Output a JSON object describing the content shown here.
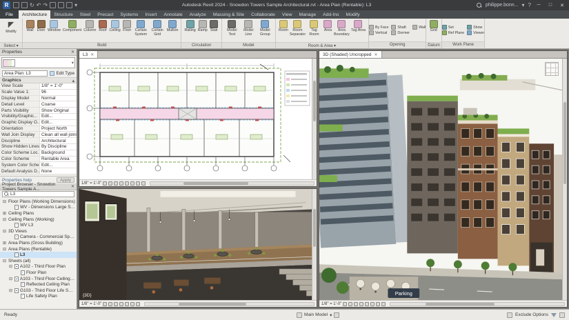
{
  "colors": {
    "accent": "#0696d7",
    "titlebar": "#393b3d",
    "area_pink": "#f6d7e7",
    "area_green": "#e3efd3",
    "roof_green": "#7fae4e",
    "selection": "#cde3f7"
  },
  "icons": {
    "undo": "↶",
    "redo": "↷",
    "sync": "↻",
    "close": "✕",
    "minimize": "─",
    "maximize": "□",
    "dropdown": "▾",
    "collapse": "▴",
    "help": "?",
    "cursor": "◤"
  },
  "title_bar": {
    "logo_letter": "R",
    "title": "Autodesk Revit 2024 - Snowdon Towers Sample Architectural.rvt - Area Plan (Rentable): L3",
    "user": "philippe.bonn..."
  },
  "menu": {
    "file": "File",
    "tabs": [
      {
        "label": "Architecture"
      },
      {
        "label": "Structure"
      },
      {
        "label": "Steel"
      },
      {
        "label": "Precast"
      },
      {
        "label": "Systems"
      },
      {
        "label": "Insert"
      },
      {
        "label": "Annotate"
      },
      {
        "label": "Analyze"
      },
      {
        "label": "Massing & Site"
      },
      {
        "label": "Collaborate"
      },
      {
        "label": "View"
      },
      {
        "label": "Manage"
      },
      {
        "label": "Add-Ins"
      },
      {
        "label": "Modify"
      }
    ]
  },
  "ribbon": {
    "modify_label": "Modify",
    "panel_select": "Select ▾",
    "build": [
      "Wall",
      "Door",
      "Window",
      "Component",
      "Column",
      "Roof",
      "Ceiling",
      "Floor",
      "Curtain System",
      "Curtain Grid",
      "Mullion"
    ],
    "panel_build": "Build",
    "circulation": [
      "Railing",
      "Ramp",
      "Stair"
    ],
    "panel_circulation": "Circulation",
    "model": [
      "Model Text",
      "Model Line",
      "Model Group"
    ],
    "panel_model": "Model",
    "room_area": [
      "Room",
      "Room Separator",
      "Tag Room",
      "Area",
      "Area Boundary",
      "Tag Area"
    ],
    "panel_room_area": "Room & Area ▾",
    "opening": [
      "By Face",
      "Shaft",
      "Wall",
      "Vertical",
      "Dormer"
    ],
    "panel_opening": "Opening",
    "datum": [
      "Grid"
    ],
    "panel_datum": "Datum",
    "work_plane": [
      "Set",
      "Show",
      "Ref Plane",
      "Viewer"
    ],
    "panel_work_plane": "Work Plane"
  },
  "properties": {
    "header": "Properties",
    "type_selector": "Area Plan: L3",
    "edit_type": "Edit Type",
    "group_graphics": "Graphics",
    "rows": [
      {
        "label": "View Scale",
        "value": "1/8\" = 1'-0\""
      },
      {
        "label": "Scale Value   1:",
        "value": "96"
      },
      {
        "label": "Display Model",
        "value": "Normal"
      },
      {
        "label": "Detail Level",
        "value": "Coarse"
      },
      {
        "label": "Parts Visibility",
        "value": "Show Original"
      },
      {
        "label": "Visibility/Graphic...",
        "value": "Edit..."
      },
      {
        "label": "Graphic Display O...",
        "value": "Edit..."
      },
      {
        "label": "Orientation",
        "value": "Project North"
      },
      {
        "label": "Wall Join Display",
        "value": "Clean all wall joins"
      },
      {
        "label": "Discipline",
        "value": "Architectural"
      },
      {
        "label": "Show Hidden Lines",
        "value": "By Discipline"
      },
      {
        "label": "Color Scheme Loc...",
        "value": "Background"
      },
      {
        "label": "Color Scheme",
        "value": "Rentable Area"
      },
      {
        "label": "System Color Sche...",
        "value": "Edit..."
      },
      {
        "label": "Default Analysis D...",
        "value": "None"
      }
    ],
    "help": "Properties help",
    "apply": "Apply"
  },
  "project_browser": {
    "header": "Project Browser - Snowdon Towers Sample A...",
    "search_value": "L3",
    "items": [
      {
        "exp": "⊟",
        "label": "Floor Plans (Working Dimensions)"
      },
      {
        "exp": "",
        "label": "WV - Dimensions Large Scale"
      },
      {
        "exp": "⊞",
        "label": "Ceiling Plans"
      },
      {
        "exp": "⊟",
        "label": "Ceiling Plans (Working)"
      },
      {
        "exp": "",
        "label": "WV L3"
      },
      {
        "exp": "⊟",
        "label": "3D Views"
      },
      {
        "exp": "",
        "label": "Camera - Commercial Space 3..."
      },
      {
        "exp": "⊞",
        "label": "Area Plans (Gross Building)"
      },
      {
        "exp": "⊟",
        "label": "Area Plans (Rentable)"
      },
      {
        "exp": "",
        "label": "L3"
      },
      {
        "exp": "⊟",
        "label": "Sheets (all)"
      },
      {
        "exp": "⊟",
        "label": "A102 - Third Floor Plan"
      },
      {
        "exp": "",
        "label": "Floor Plan"
      },
      {
        "exp": "⊟",
        "label": "A103 - Third Floor Ceiling Plan"
      },
      {
        "exp": "",
        "label": "Reflected Ceiling Plan"
      },
      {
        "exp": "⊟",
        "label": "G103 - Third Floor Life Safety Plan"
      },
      {
        "exp": "",
        "label": "Life Safety Plan"
      }
    ]
  },
  "viewports": {
    "plan": {
      "tab": "L3",
      "scale": "1/8\" = 1'-0\""
    },
    "interior": {
      "label": "{3D}",
      "scale": "1/8\" = 1'-0\""
    },
    "exterior": {
      "tab": "3D (Shaded) Uncropped",
      "scale": "1/8\" = 1'-0\""
    },
    "parking_sign": "Parking"
  },
  "status_bar": {
    "left": "Ready",
    "workset": "Main Model",
    "exclude": "Exclude Options"
  }
}
